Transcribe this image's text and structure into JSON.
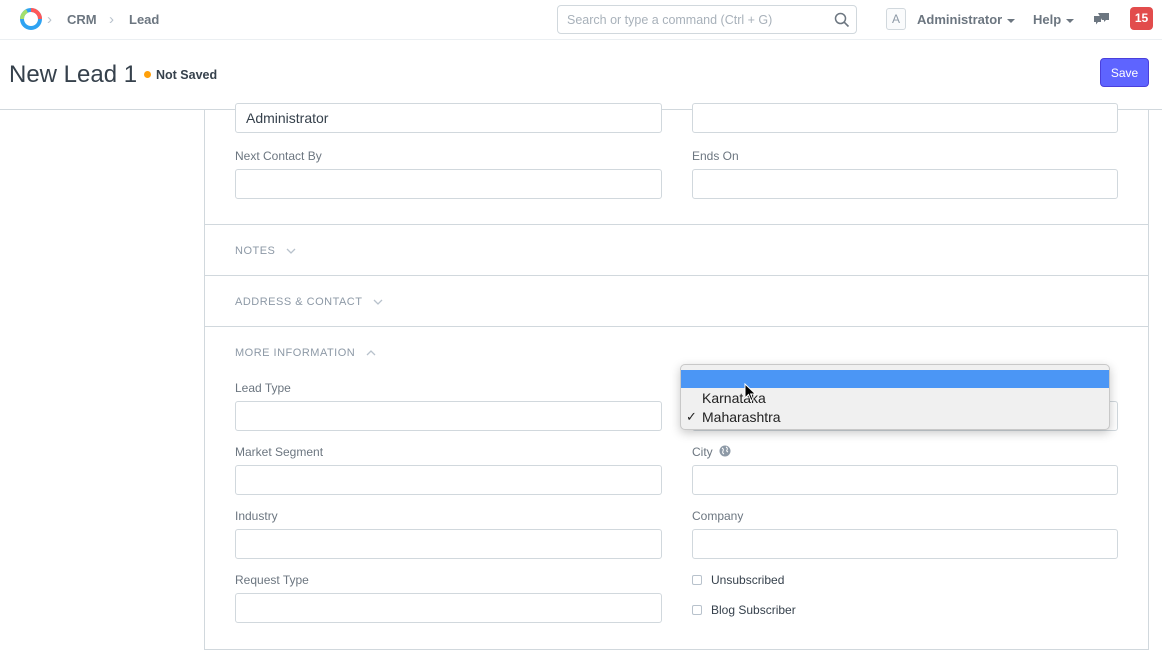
{
  "navbar": {
    "breadcrumbs": [
      "CRM",
      "Lead"
    ],
    "search_placeholder": "Search or type a command (Ctrl + G)",
    "avatar_letter": "A",
    "user_label": "Administrator",
    "help_label": "Help",
    "notification_count": "15"
  },
  "page": {
    "title": "New Lead 1",
    "status": "Not Saved",
    "save_label": "Save"
  },
  "form": {
    "top_field_value": "Administrator",
    "next_contact_by_label": "Next Contact By",
    "ends_on_label": "Ends On",
    "sections": {
      "notes": "NOTES",
      "address_contact": "ADDRESS & CONTACT",
      "more_information": "MORE INFORMATION"
    },
    "lead_type_label": "Lead Type",
    "market_segment_label": "Market Segment",
    "industry_label": "Industry",
    "request_type_label": "Request Type",
    "city_label": "City",
    "company_label": "Company",
    "unsubscribed_label": "Unsubscribed",
    "blog_subscriber_label": "Blog Subscriber"
  },
  "dropdown": {
    "options": [
      "",
      "Karnataka",
      "Maharashtra"
    ],
    "selected_index": 2,
    "highlighted_index": 0,
    "check_mark": "✓"
  },
  "colors": {
    "accent": "#5e64ff",
    "status_dot": "#ffa00a",
    "notification": "#e24c4c",
    "highlight": "#4b96f5"
  },
  "icons": [
    "app-logo-icon",
    "search-icon",
    "chat-icon",
    "chevron-down-icon",
    "chevron-up-icon",
    "globe-icon",
    "mouse-pointer-icon"
  ]
}
